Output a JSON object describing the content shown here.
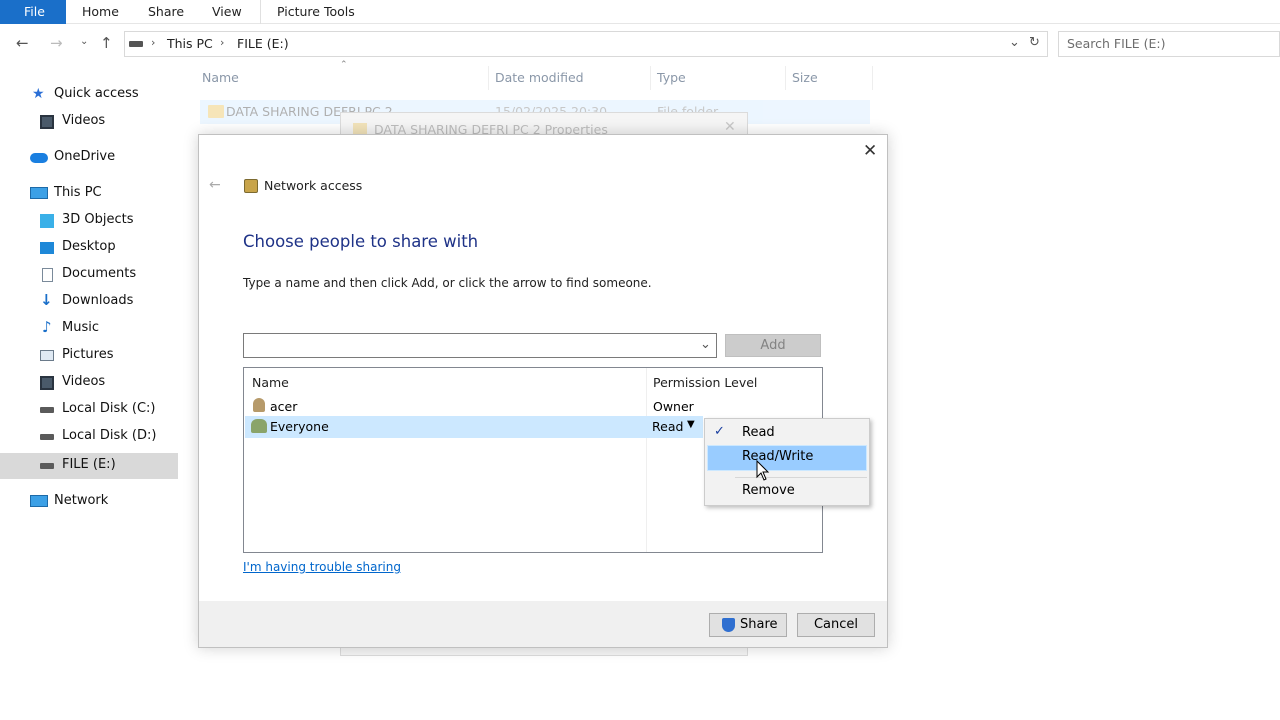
{
  "ribbon": {
    "tabs": [
      "File",
      "Home",
      "Share",
      "View",
      "Picture Tools"
    ]
  },
  "address": {
    "breadcrumb": [
      "This PC",
      "FILE (E:)"
    ],
    "search_placeholder": "Search FILE (E:)"
  },
  "sidebar": {
    "items": [
      {
        "label": "Quick access",
        "icon": "star-icon"
      },
      {
        "label": "Videos",
        "icon": "video-icon"
      },
      {
        "label": "OneDrive",
        "icon": "cloud-icon"
      },
      {
        "label": "This PC",
        "icon": "computer-icon"
      },
      {
        "label": "3D Objects",
        "icon": "cube-icon"
      },
      {
        "label": "Desktop",
        "icon": "desktop-icon"
      },
      {
        "label": "Documents",
        "icon": "document-icon"
      },
      {
        "label": "Downloads",
        "icon": "download-icon"
      },
      {
        "label": "Music",
        "icon": "music-icon"
      },
      {
        "label": "Pictures",
        "icon": "pictures-icon"
      },
      {
        "label": "Videos",
        "icon": "video-icon"
      },
      {
        "label": "Local Disk (C:)",
        "icon": "drive-icon"
      },
      {
        "label": "Local Disk (D:)",
        "icon": "drive-icon"
      },
      {
        "label": "FILE (E:)",
        "icon": "drive-icon",
        "selected": true
      },
      {
        "label": "Network",
        "icon": "network-icon"
      }
    ]
  },
  "file_list": {
    "columns": [
      "Name",
      "Date modified",
      "Type",
      "Size"
    ],
    "rows": [
      {
        "name": "DATA SHARING DEFRI PC 2",
        "date": "15/02/2025 20:30",
        "type": "File folder"
      }
    ]
  },
  "bg_dialog": {
    "title": "DATA SHARING DEFRI PC 2 Properties"
  },
  "dialog": {
    "window_title": "Network access",
    "heading": "Choose people to share with",
    "instruction": "Type a name and then click Add, or click the arrow to find someone.",
    "input_value": "",
    "add_label": "Add",
    "list_headers": [
      "Name",
      "Permission Level"
    ],
    "users": [
      {
        "name": "acer",
        "permission": "Owner"
      },
      {
        "name": "Everyone",
        "permission": "Read"
      }
    ],
    "trouble_link": "I'm having trouble sharing",
    "share_label": "Share",
    "cancel_label": "Cancel"
  },
  "context_menu": {
    "items": [
      {
        "label": "Read",
        "checked": true
      },
      {
        "label": "Read/Write",
        "hovered": true
      },
      {
        "label": "Remove"
      }
    ]
  },
  "colors": {
    "accent": "#1a6fc9",
    "selection": "#cce8ff",
    "menu_hover": "#91c9f7",
    "heading": "#1e3287",
    "link": "#0066cc"
  }
}
